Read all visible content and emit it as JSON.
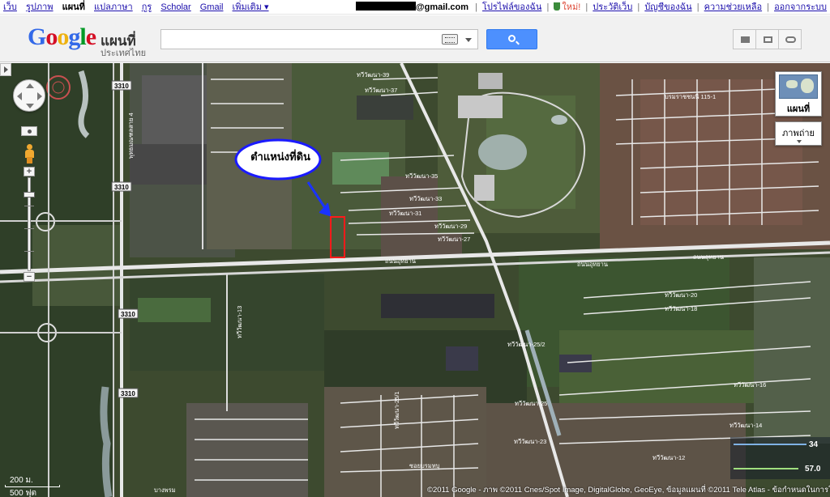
{
  "topnav": {
    "links": [
      "เว็บ",
      "รูปภาพ",
      "แผนที่",
      "แปลภาษา",
      "กูรู",
      "Scholar",
      "Gmail",
      "เพิ่มเติม ▾"
    ],
    "active_index": 2
  },
  "account": {
    "email_suffix": "@gmail.com",
    "links": [
      "โปรไฟล์ของฉัน",
      "ใหม่!",
      "ประวัติเว็บ",
      "บัญชีของฉัน",
      "ความช่วยเหลือ",
      "ออกจากระบบ"
    ]
  },
  "header": {
    "logo_letters": [
      "G",
      "o",
      "o",
      "g",
      "l",
      "e"
    ],
    "logo_product": "แผนที่",
    "logo_country": "ประเทศไทย",
    "search_value": "",
    "tool_icons": [
      "print-icon",
      "mail-icon",
      "link-icon"
    ]
  },
  "map": {
    "annotation_label": "ตำแหน่งที่ดิน",
    "maptype": {
      "earth_label": "แผนที่",
      "photo_label": "ภาพถ่าย"
    },
    "route_shields": [
      "3310",
      "3310",
      "3310",
      "3310"
    ],
    "road_labels": [
      "ทวีวัฒนา-39",
      "ทวีวัฒนา-37",
      "ทวีวัฒนา-35",
      "ทวีวัฒนา-33",
      "ทวีวัฒนา-31",
      "ทวีวัฒนา-29",
      "ทวีวัฒนา-27",
      "ถนนอุทยาน",
      "ถนนอุทยาน",
      "ถนนอุทยาน",
      "ทวีวัฒนา-20",
      "ทวีวัฒนา-18",
      "ทวีวัฒนา-16",
      "ทวีวัฒนา-14",
      "ทวีวัฒนา-12",
      "บรมราชชนนี 115-1",
      "พุทธมณฑลสาย 4",
      "ทวีวัฒนา-25/2",
      "ทวีวัฒนา-25",
      "ทวีวัฒนา-23",
      "ทวีวัฒนา-25/1",
      "ซอยบรมทบุ",
      "ทวีวัฒนา-13",
      "บางพรม"
    ],
    "scale": {
      "metric": "200 ม.",
      "imperial": "500 ฟุต"
    },
    "copyright": "©2011 Google - ภาพ ©2011 Cnes/Spot Image, DigitalGlobe, GeoEye, ข้อมูลแผนที่ ©2011 Tele Atlas - ข้อกำหนดในการใช้บริการ",
    "elevation": [
      "34",
      "57.0"
    ],
    "colors": {
      "annotation_ellipse": "#1a1aff",
      "annotation_arrow": "#1a33ff",
      "parcel": "#ff1a1a",
      "road": "#e8e8e8"
    }
  }
}
